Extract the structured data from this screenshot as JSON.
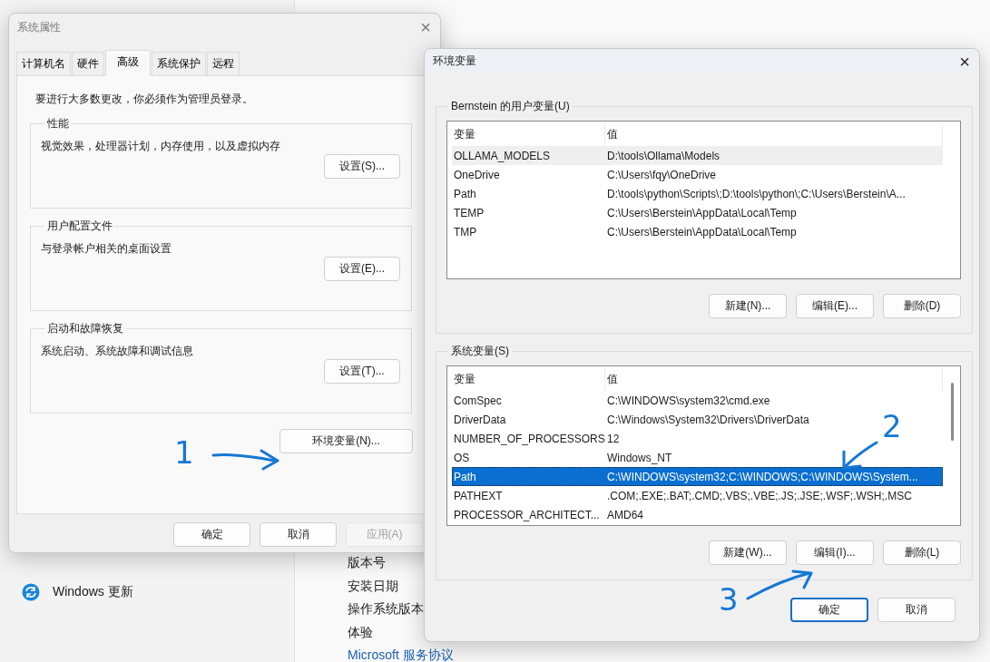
{
  "settings_background": {
    "nav_items": [
      {
        "label": "Windows 更新",
        "kind": "update"
      }
    ],
    "info_labels": [
      {
        "label": "版本号",
        "kind": "text"
      },
      {
        "label": "安装日期",
        "kind": "text"
      },
      {
        "label": "操作系统版本",
        "kind": "text"
      },
      {
        "label": "体验",
        "kind": "text"
      },
      {
        "label": "Microsoft 服务协议",
        "kind": "link"
      }
    ]
  },
  "system_properties": {
    "title": "系统属性",
    "close": "×",
    "tabs": [
      {
        "label": "计算机名",
        "selected": false
      },
      {
        "label": "硬件",
        "selected": false
      },
      {
        "label": "高级",
        "selected": true
      },
      {
        "label": "系统保护",
        "selected": false
      },
      {
        "label": "远程",
        "selected": false
      }
    ],
    "notice": "要进行大多数更改，你必须作为管理员登录。",
    "groups": [
      {
        "title": "性能",
        "description": "视觉效果，处理器计划，内存使用，以及虚拟内存",
        "button": "设置(S)..."
      },
      {
        "title": "用户配置文件",
        "description": "与登录帐户相关的桌面设置",
        "button": "设置(E)..."
      },
      {
        "title": "启动和故障恢复",
        "description": "系统启动、系统故障和调试信息",
        "button": "设置(T)..."
      }
    ],
    "env_button": "环境变量(N)...",
    "buttons": [
      {
        "label": "确定",
        "disabled": false
      },
      {
        "label": "取消",
        "disabled": false
      },
      {
        "label": "应用(A)",
        "disabled": true
      }
    ]
  },
  "environment_variables": {
    "title": "环境变量",
    "close": "×",
    "user_variables": {
      "title": "Bernstein 的用户变量(U)",
      "columns": [
        "变量",
        "值"
      ],
      "rows": [
        {
          "name": "OLLAMA_MODELS",
          "value": "D:\\tools\\Ollama\\Models",
          "hovered": true
        },
        {
          "name": "OneDrive",
          "value": "C:\\Users\\fqy\\OneDrive",
          "hovered": false
        },
        {
          "name": "Path",
          "value": "D:\\tools\\python\\Scripts\\;D:\\tools\\python\\;C:\\Users\\Berstein\\A...",
          "hovered": false
        },
        {
          "name": "TEMP",
          "value": "C:\\Users\\Berstein\\AppData\\Local\\Temp",
          "hovered": false
        },
        {
          "name": "TMP",
          "value": "C:\\Users\\Berstein\\AppData\\Local\\Temp",
          "hovered": false
        }
      ],
      "buttons": [
        "新建(N)...",
        "编辑(E)...",
        "删除(D)"
      ]
    },
    "system_variables": {
      "title": "系统变量(S)",
      "columns": [
        "变量",
        "值"
      ],
      "rows": [
        {
          "name": "ComSpec",
          "value": "C:\\WINDOWS\\system32\\cmd.exe",
          "selected": false
        },
        {
          "name": "DriverData",
          "value": "C:\\Windows\\System32\\Drivers\\DriverData",
          "selected": false
        },
        {
          "name": "NUMBER_OF_PROCESSORS",
          "value": "12",
          "selected": false
        },
        {
          "name": "OS",
          "value": "Windows_NT",
          "selected": false
        },
        {
          "name": "Path",
          "value": "C:\\WINDOWS\\system32;C:\\WINDOWS;C:\\WINDOWS\\System...",
          "selected": true
        },
        {
          "name": "PATHEXT",
          "value": ".COM;.EXE;.BAT;.CMD;.VBS;.VBE;.JS;.JSE;.WSF;.WSH;.MSC",
          "selected": false
        },
        {
          "name": "PROCESSOR_ARCHITECT...",
          "value": "AMD64",
          "selected": false
        }
      ],
      "buttons": [
        "新建(W)...",
        "编辑(I)...",
        "删除(L)"
      ]
    },
    "buttons": [
      {
        "label": "确定",
        "default": true
      },
      {
        "label": "取消",
        "default": false
      }
    ]
  },
  "annotations": [
    {
      "label": "1"
    },
    {
      "label": "2"
    },
    {
      "label": "3"
    }
  ]
}
